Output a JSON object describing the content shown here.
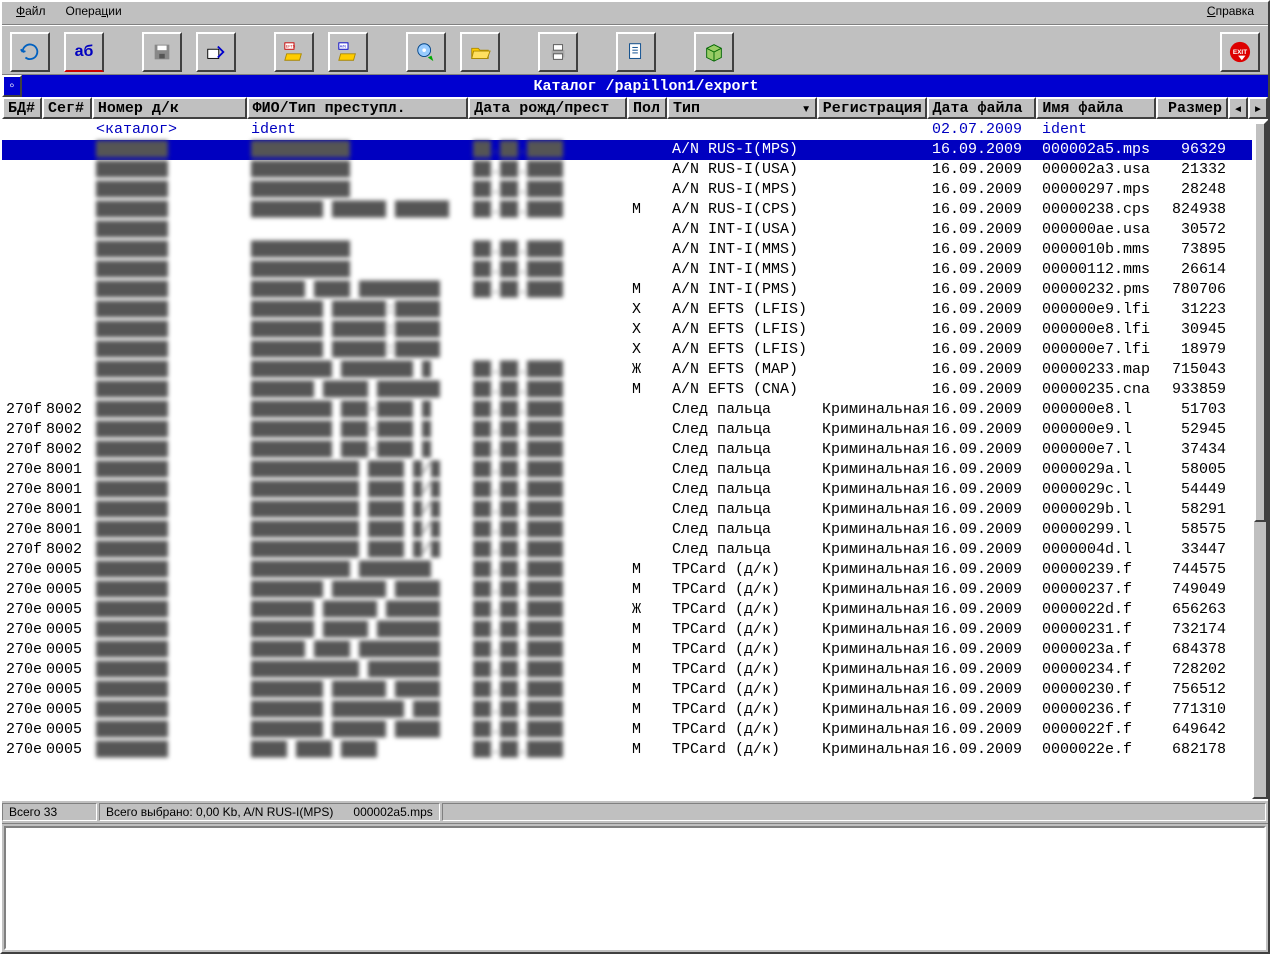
{
  "menu": {
    "file": "Файл",
    "ops": "Операции",
    "help": "Справка",
    "ul_file": "Ф",
    "ul_ops": "ц",
    "ul_help": "С"
  },
  "toolbar": {
    "refresh": "⟳",
    "textmode": "аб",
    "save": "💾",
    "export": "⇲",
    "efts": "EFTS",
    "an": "A/N",
    "burn": "💿",
    "folder": "📂",
    "print": "🖨",
    "report": "📋",
    "package": "📦",
    "exit": "EXIT"
  },
  "pathbar": {
    "label": "Каталог  /papillon1/export",
    "corner": "◦"
  },
  "columns": {
    "c0": "БД#",
    "c1": "Сег#",
    "c2": "Номер д/к",
    "c3": "ФИО/Тип преступл.",
    "c4": "Дата рожд/прест",
    "c5": "Пол",
    "c6": "Тип",
    "c7": "Регистрация",
    "c8": "Дата файла",
    "c9": "Имя файла",
    "c10": "Размер",
    "scroll": "◂",
    "more": "▸"
  },
  "catalog_row": {
    "c2": "<каталог>",
    "c3": "ident",
    "c8": "02.07.2009",
    "c9": "ident"
  },
  "rows": [
    {
      "sel": true,
      "c0": "",
      "c1": "",
      "c2": "████████",
      "c3": "███████████",
      "c4": "██.██.████",
      "c5": "",
      "c6": "A/N RUS-I(MPS)",
      "c7": "",
      "c8": "16.09.2009",
      "c9": "000002a5.mps",
      "c10": "96329"
    },
    {
      "c0": "",
      "c1": "",
      "c2": "████████",
      "c3": "███████████",
      "c4": "██.██.████",
      "c5": "",
      "c6": "A/N RUS-I(USA)",
      "c7": "",
      "c8": "16.09.2009",
      "c9": "000002a3.usa",
      "c10": "21332"
    },
    {
      "c0": "",
      "c1": "",
      "c2": "████████",
      "c3": "███████████",
      "c4": "██.██.████",
      "c5": "",
      "c6": "A/N RUS-I(MPS)",
      "c7": "",
      "c8": "16.09.2009",
      "c9": "00000297.mps",
      "c10": "28248"
    },
    {
      "c0": "",
      "c1": "",
      "c2": "████████",
      "c3": "████████ ██████ ██████",
      "c4": "██.██.████",
      "c5": "М",
      "c6": "A/N RUS-I(CPS)",
      "c7": "",
      "c8": "16.09.2009",
      "c9": "00000238.cps",
      "c10": "824938"
    },
    {
      "c0": "",
      "c1": "",
      "c2": "████████",
      "c3": "",
      "c4": "",
      "c5": "",
      "c6": "A/N INT-I(USA)",
      "c7": "",
      "c8": "16.09.2009",
      "c9": "000000ae.usa",
      "c10": "30572"
    },
    {
      "c0": "",
      "c1": "",
      "c2": "████████",
      "c3": "███████████",
      "c4": "██.██.████",
      "c5": "",
      "c6": "A/N INT-I(MMS)",
      "c7": "",
      "c8": "16.09.2009",
      "c9": "0000010b.mms",
      "c10": "73895"
    },
    {
      "c0": "",
      "c1": "",
      "c2": "████████",
      "c3": "███████████",
      "c4": "██.██.████",
      "c5": "",
      "c6": "A/N INT-I(MMS)",
      "c7": "",
      "c8": "16.09.2009",
      "c9": "00000112.mms",
      "c10": "26614"
    },
    {
      "c0": "",
      "c1": "",
      "c2": "████████",
      "c3": "██████ ████ █████████",
      "c4": "██.██.████",
      "c5": "М",
      "c6": "A/N INT-I(PMS)",
      "c7": "",
      "c8": "16.09.2009",
      "c9": "00000232.pms",
      "c10": "780706"
    },
    {
      "c0": "",
      "c1": "",
      "c2": "████████",
      "c3": "████████ ██████:█████",
      "c4": "",
      "c5": "Х",
      "c6": "A/N EFTS (LFIS)",
      "c7": "",
      "c8": "16.09.2009",
      "c9": "000000e9.lfi",
      "c10": "31223"
    },
    {
      "c0": "",
      "c1": "",
      "c2": "████████",
      "c3": "████████ ██████:█████",
      "c4": "",
      "c5": "Х",
      "c6": "A/N EFTS (LFIS)",
      "c7": "",
      "c8": "16.09.2009",
      "c9": "000000e8.lfi",
      "c10": "30945"
    },
    {
      "c0": "",
      "c1": "",
      "c2": "████████",
      "c3": "████████ ██████:█████",
      "c4": "",
      "c5": "Х",
      "c6": "A/N EFTS (LFIS)",
      "c7": "",
      "c8": "16.09.2009",
      "c9": "000000e7.lfi",
      "c10": "18979"
    },
    {
      "c0": "",
      "c1": "",
      "c2": "████████",
      "c3": "█████████ ████████ █",
      "c4": "██.██.████",
      "c5": "Ж",
      "c6": "A/N EFTS (MAP)",
      "c7": "",
      "c8": "16.09.2009",
      "c9": "00000233.map",
      "c10": "715043"
    },
    {
      "c0": "",
      "c1": "",
      "c2": "████████",
      "c3": "███████ █████ ███████",
      "c4": "██.██.████",
      "c5": "М",
      "c6": "A/N EFTS (CNA)",
      "c7": "",
      "c8": "16.09.2009",
      "c9": "00000235.cna",
      "c10": "933859"
    },
    {
      "c0": "270f",
      "c1": "8002",
      "c2": "████████",
      "c3": "█████████ ███-████ █",
      "c4": "██.██.████",
      "c5": "",
      "c6": "След пальца",
      "c7": "Криминальная",
      "c8": "16.09.2009",
      "c9": "000000e8.l",
      "c10": "51703"
    },
    {
      "c0": "270f",
      "c1": "8002",
      "c2": "████████",
      "c3": "█████████ ███-████ █",
      "c4": "██.██.████",
      "c5": "",
      "c6": "След пальца",
      "c7": "Криминальная",
      "c8": "16.09.2009",
      "c9": "000000e9.l",
      "c10": "52945"
    },
    {
      "c0": "270f",
      "c1": "8002",
      "c2": "████████",
      "c3": "█████████ ███-████ █",
      "c4": "██.██.████",
      "c5": "",
      "c6": "След пальца",
      "c7": "Криминальная",
      "c8": "16.09.2009",
      "c9": "000000e7.l",
      "c10": "37434"
    },
    {
      "c0": "270e",
      "c1": "8001",
      "c2": "████████",
      "c3": "████████████ ████ █/█",
      "c4": "██.██.████",
      "c5": "",
      "c6": "След пальца",
      "c7": "Криминальная",
      "c8": "16.09.2009",
      "c9": "0000029a.l",
      "c10": "58005"
    },
    {
      "c0": "270e",
      "c1": "8001",
      "c2": "████████",
      "c3": "████████████ ████ █/█",
      "c4": "██.██.████",
      "c5": "",
      "c6": "След пальца",
      "c7": "Криминальная",
      "c8": "16.09.2009",
      "c9": "0000029c.l",
      "c10": "54449"
    },
    {
      "c0": "270e",
      "c1": "8001",
      "c2": "████████",
      "c3": "████████████ ████ █/█",
      "c4": "██.██.████",
      "c5": "",
      "c6": "След пальца",
      "c7": "Криминальная",
      "c8": "16.09.2009",
      "c9": "0000029b.l",
      "c10": "58291"
    },
    {
      "c0": "270e",
      "c1": "8001",
      "c2": "████████",
      "c3": "████████████ ████ █/█",
      "c4": "██.██.████",
      "c5": "",
      "c6": "След пальца",
      "c7": "Криминальная",
      "c8": "16.09.2009",
      "c9": "00000299.l",
      "c10": "58575"
    },
    {
      "c0": "270f",
      "c1": "8002",
      "c2": "████████",
      "c3": "████████████ ████ █/█",
      "c4": "██.██.████",
      "c5": "",
      "c6": "След пальца",
      "c7": "Криминальная",
      "c8": "16.09.2009",
      "c9": "0000004d.l",
      "c10": "33447"
    },
    {
      "c0": "270e",
      "c1": "0005",
      "c2": "████████",
      "c3": "███████████ ████████",
      "c4": "██.██.████",
      "c5": "М",
      "c6": "TPCard (д/к)",
      "c7": "Криминальная",
      "c8": "16.09.2009",
      "c9": "00000239.f",
      "c10": "744575"
    },
    {
      "c0": "270e",
      "c1": "0005",
      "c2": "████████",
      "c3": "████████ ██████ █████",
      "c4": "██.██.████",
      "c5": "М",
      "c6": "TPCard (д/к)",
      "c7": "Криминальная",
      "c8": "16.09.2009",
      "c9": "00000237.f",
      "c10": "749049"
    },
    {
      "c0": "270e",
      "c1": "0005",
      "c2": "████████",
      "c3": "███████ ██████ ██████",
      "c4": "██.██.████",
      "c5": "Ж",
      "c6": "TPCard (д/к)",
      "c7": "Криминальная",
      "c8": "16.09.2009",
      "c9": "0000022d.f",
      "c10": "656263"
    },
    {
      "c0": "270e",
      "c1": "0005",
      "c2": "████████",
      "c3": "███████ █████ ███████",
      "c4": "██.██.████",
      "c5": "М",
      "c6": "TPCard (д/к)",
      "c7": "Криминальная",
      "c8": "16.09.2009",
      "c9": "00000231.f",
      "c10": "732174"
    },
    {
      "c0": "270e",
      "c1": "0005",
      "c2": "████████",
      "c3": "██████ ████ █████████",
      "c4": "██.██.████",
      "c5": "М",
      "c6": "TPCard (д/к)",
      "c7": "Криминальная",
      "c8": "16.09.2009",
      "c9": "0000023a.f",
      "c10": "684378"
    },
    {
      "c0": "270e",
      "c1": "0005",
      "c2": "████████",
      "c3": "████████████ ████████",
      "c4": "██.██.████",
      "c5": "М",
      "c6": "TPCard (д/к)",
      "c7": "Криминальная",
      "c8": "16.09.2009",
      "c9": "00000234.f",
      "c10": "728202"
    },
    {
      "c0": "270e",
      "c1": "0005",
      "c2": "████████",
      "c3": "████████ ██████ █████",
      "c4": "██.██.████",
      "c5": "М",
      "c6": "TPCard (д/к)",
      "c7": "Криминальная",
      "c8": "16.09.2009",
      "c9": "00000230.f",
      "c10": "756512"
    },
    {
      "c0": "270e",
      "c1": "0005",
      "c2": "████████",
      "c3": "████████ ████████ ███",
      "c4": "██.██.████",
      "c5": "М",
      "c6": "TPCard (д/к)",
      "c7": "Криминальная",
      "c8": "16.09.2009",
      "c9": "00000236.f",
      "c10": "771310"
    },
    {
      "c0": "270e",
      "c1": "0005",
      "c2": "████████",
      "c3": "████████ ██████ █████",
      "c4": "██.██.████",
      "c5": "М",
      "c6": "TPCard (д/к)",
      "c7": "Криминальная",
      "c8": "16.09.2009",
      "c9": "0000022f.f",
      "c10": "649642"
    },
    {
      "c0": "270e",
      "c1": "0005",
      "c2": "████████",
      "c3": "████ ████ ████",
      "c4": "██.██.████",
      "c5": "М",
      "c6": "TPCard (д/к)",
      "c7": "Криминальная",
      "c8": "16.09.2009",
      "c9": "0000022e.f",
      "c10": "682178"
    }
  ],
  "status": {
    "total": "Всего 33",
    "selected": "Всего выбрано: 0,00 Kb, A/N RUS-I(MPS)",
    "filename": "000002a5.mps"
  }
}
